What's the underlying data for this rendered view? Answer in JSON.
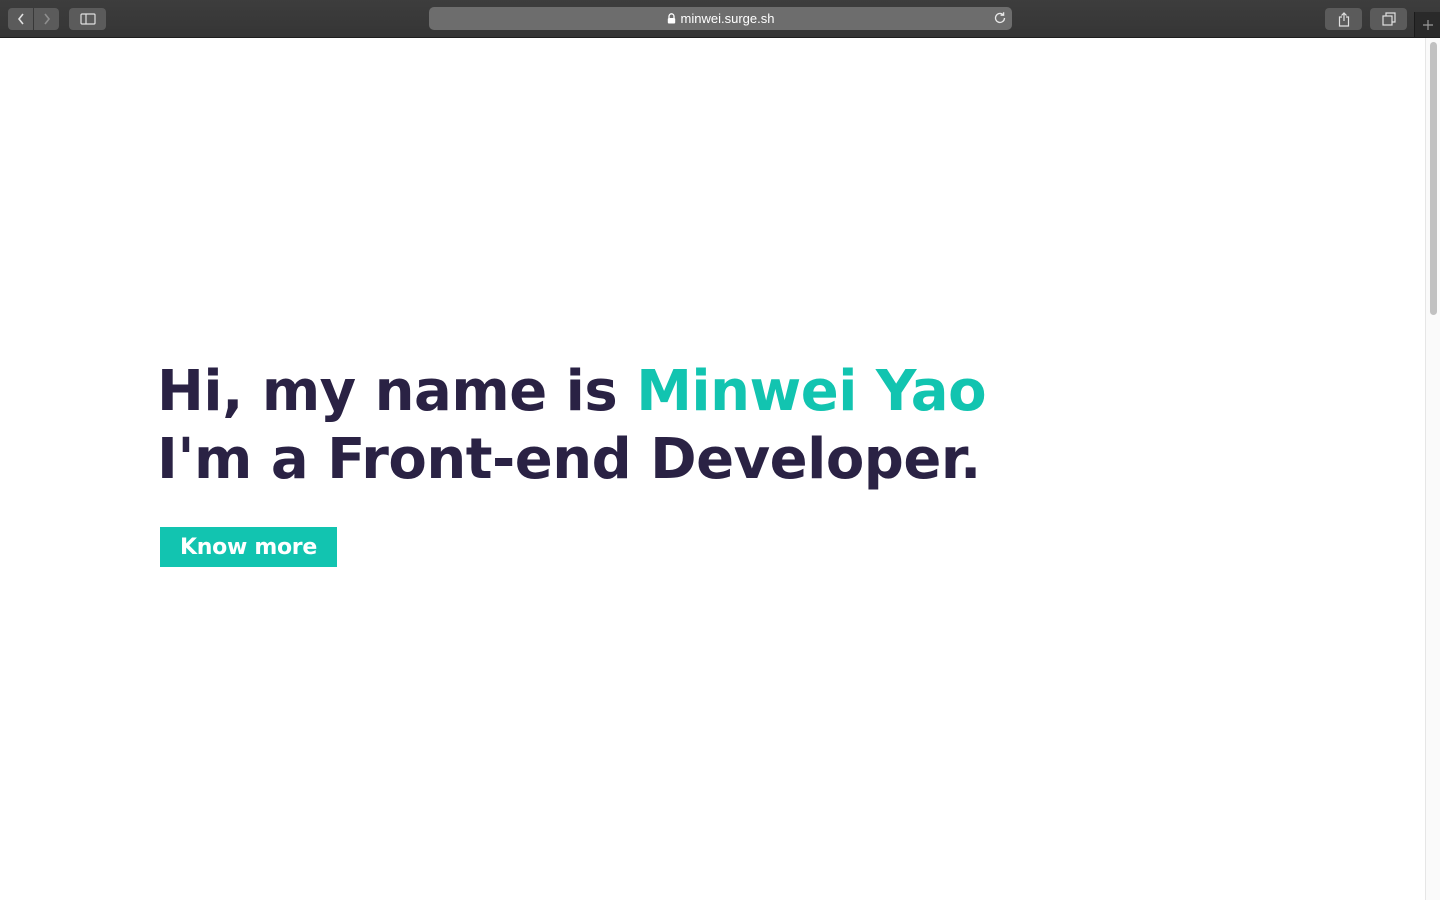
{
  "browser": {
    "url": "minwei.surge.sh",
    "icons": {
      "back": "chevron-left-icon",
      "forward": "chevron-right-icon",
      "sidebar": "sidebar-icon",
      "lock": "lock-icon",
      "reload": "reload-icon",
      "share": "share-icon",
      "tabs": "tabs-overview-icon",
      "new_tab": "plus-icon"
    }
  },
  "hero": {
    "line1_prefix": "Hi, my name is ",
    "name": "Minwei Yao",
    "line2": "I'm a Front-end Developer.",
    "cta_label": "Know more"
  },
  "colors": {
    "heading": "#2a2244",
    "accent": "#12c4b0",
    "background": "#ffffff"
  }
}
